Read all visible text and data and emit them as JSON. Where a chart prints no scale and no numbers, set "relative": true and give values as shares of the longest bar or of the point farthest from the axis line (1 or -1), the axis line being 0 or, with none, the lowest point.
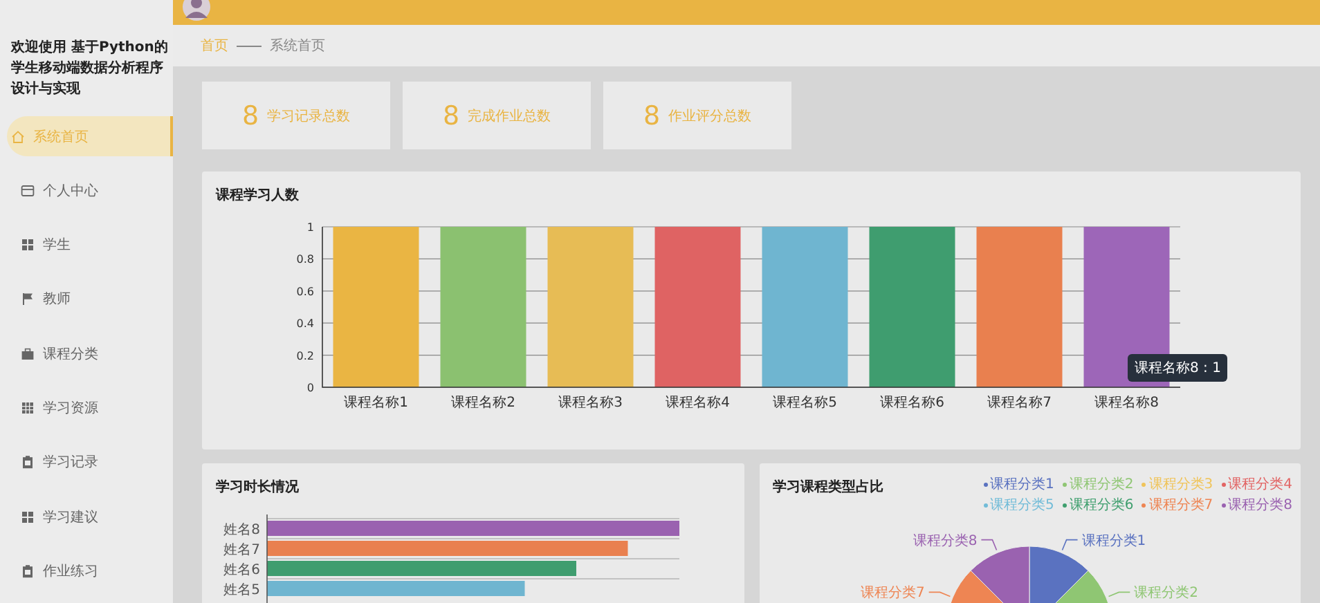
{
  "sidebar": {
    "title": "欢迎使用 基于Python的学生移动端数据分析程序设计与实现",
    "items": [
      {
        "label": "系统首页",
        "kind": "home",
        "selected": true
      },
      {
        "label": "个人中心",
        "kind": "card",
        "selected": false
      },
      {
        "label": "学生",
        "kind": "grid",
        "selected": false
      },
      {
        "label": "教师",
        "kind": "flag",
        "selected": false
      },
      {
        "label": "课程分类",
        "kind": "briefcase",
        "selected": false
      },
      {
        "label": "学习资源",
        "kind": "table",
        "selected": false
      },
      {
        "label": "学习记录",
        "kind": "clipboard",
        "selected": false
      },
      {
        "label": "学习建议",
        "kind": "grid",
        "selected": false
      },
      {
        "label": "作业练习",
        "kind": "clipboard",
        "selected": false
      }
    ]
  },
  "breadcrumb": {
    "home": "首页",
    "current": "系统首页"
  },
  "stats": [
    {
      "value": "8",
      "label": "学习记录总数"
    },
    {
      "value": "8",
      "label": "完成作业总数"
    },
    {
      "value": "8",
      "label": "作业评分总数"
    }
  ],
  "course_chart": {
    "title": "课程学习人数",
    "tooltip": "课程名称8 : 1",
    "chart_data": {
      "type": "bar",
      "categories": [
        "课程名称1",
        "课程名称2",
        "课程名称3",
        "课程名称4",
        "课程名称5",
        "课程名称6",
        "课程名称7",
        "课程名称8"
      ],
      "values": [
        1,
        1,
        1,
        1,
        1,
        1,
        1,
        1
      ],
      "ylim": [
        0,
        1
      ],
      "yticks": [
        0,
        0.2,
        0.4,
        0.6,
        0.8,
        1
      ],
      "grid": true
    }
  },
  "duration_chart": {
    "title": "学习时长情况",
    "chart_data": {
      "type": "bar",
      "orientation": "horizontal",
      "relative": true,
      "categories": [
        "姓名8",
        "姓名7",
        "姓名6",
        "姓名5"
      ],
      "values": [
        1,
        0.875,
        0.75,
        0.625
      ]
    }
  },
  "type_chart": {
    "title": "学习课程类型占比",
    "legend": [
      {
        "label": "课程分类1",
        "color": "#5a72c0"
      },
      {
        "label": "课程分类2",
        "color": "#8fc673"
      },
      {
        "label": "课程分类3",
        "color": "#f0c45a"
      },
      {
        "label": "课程分类4",
        "color": "#e26464"
      },
      {
        "label": "课程分类5",
        "color": "#72bcd8"
      },
      {
        "label": "课程分类6",
        "color": "#3f9f6e"
      },
      {
        "label": "课程分类7",
        "color": "#ee8553"
      },
      {
        "label": "课程分类8",
        "color": "#9a62b0"
      }
    ],
    "pie_labels": [
      "课程分类8",
      "课程分类1",
      "课程分类7",
      "课程分类2"
    ]
  }
}
